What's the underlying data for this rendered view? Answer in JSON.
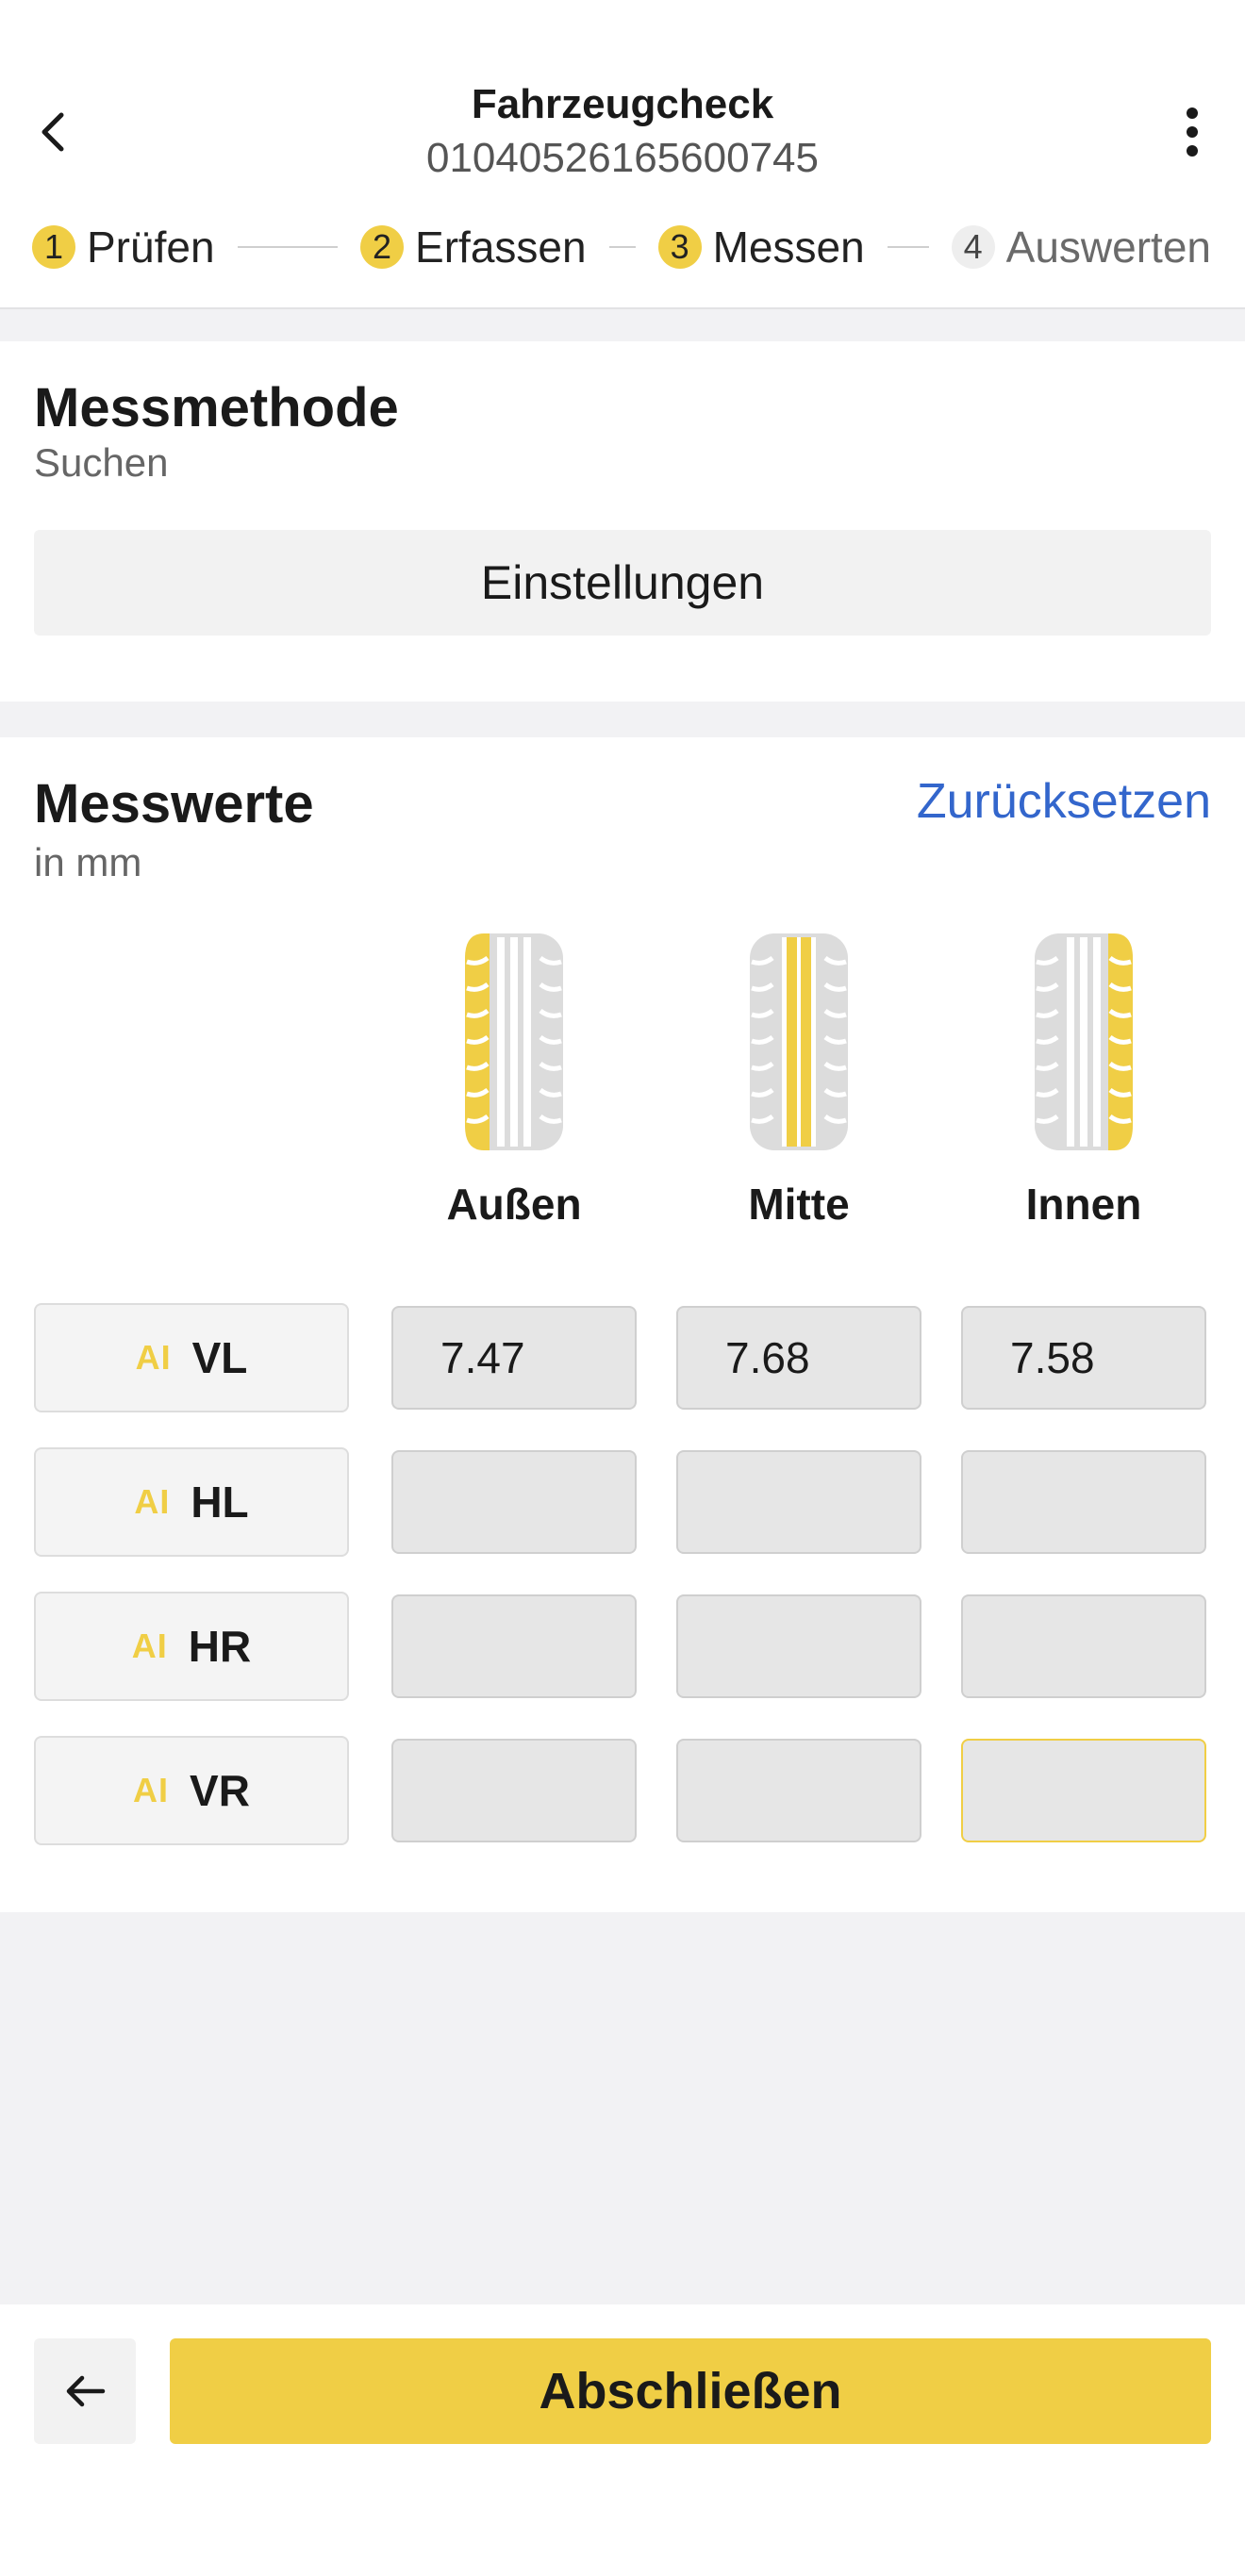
{
  "header": {
    "title": "Fahrzeugcheck",
    "subtitle": "01040526165600745",
    "back_icon": "chevron-left-icon",
    "more_icon": "more-vertical-icon"
  },
  "stepper": {
    "steps": [
      {
        "num": "1",
        "label": "Prüfen",
        "state": "done"
      },
      {
        "num": "2",
        "label": "Erfassen",
        "state": "done"
      },
      {
        "num": "3",
        "label": "Messen",
        "state": "active"
      },
      {
        "num": "4",
        "label": "Auswerten",
        "state": "pending"
      }
    ]
  },
  "method": {
    "title": "Messmethode",
    "subtitle": "Suchen",
    "settings_label": "Einstellungen"
  },
  "values": {
    "title": "Messwerte",
    "unit": "in mm",
    "reset_label": "Zurücksetzen",
    "columns": [
      "Außen",
      "Mitte",
      "Innen"
    ],
    "ai_label": "AI",
    "rows": [
      {
        "name": "VL",
        "values": [
          "7.47",
          "7.68",
          "7.58"
        ]
      },
      {
        "name": "HL",
        "values": [
          "",
          "",
          ""
        ]
      },
      {
        "name": "HR",
        "values": [
          "",
          "",
          ""
        ]
      },
      {
        "name": "VR",
        "values": [
          "",
          "",
          ""
        ]
      }
    ]
  },
  "footer": {
    "back_icon": "arrow-left-icon",
    "finish_label": "Abschließen"
  },
  "colors": {
    "accent": "#f0ce45",
    "link": "#3366cc",
    "background": "#f2f2f4"
  }
}
